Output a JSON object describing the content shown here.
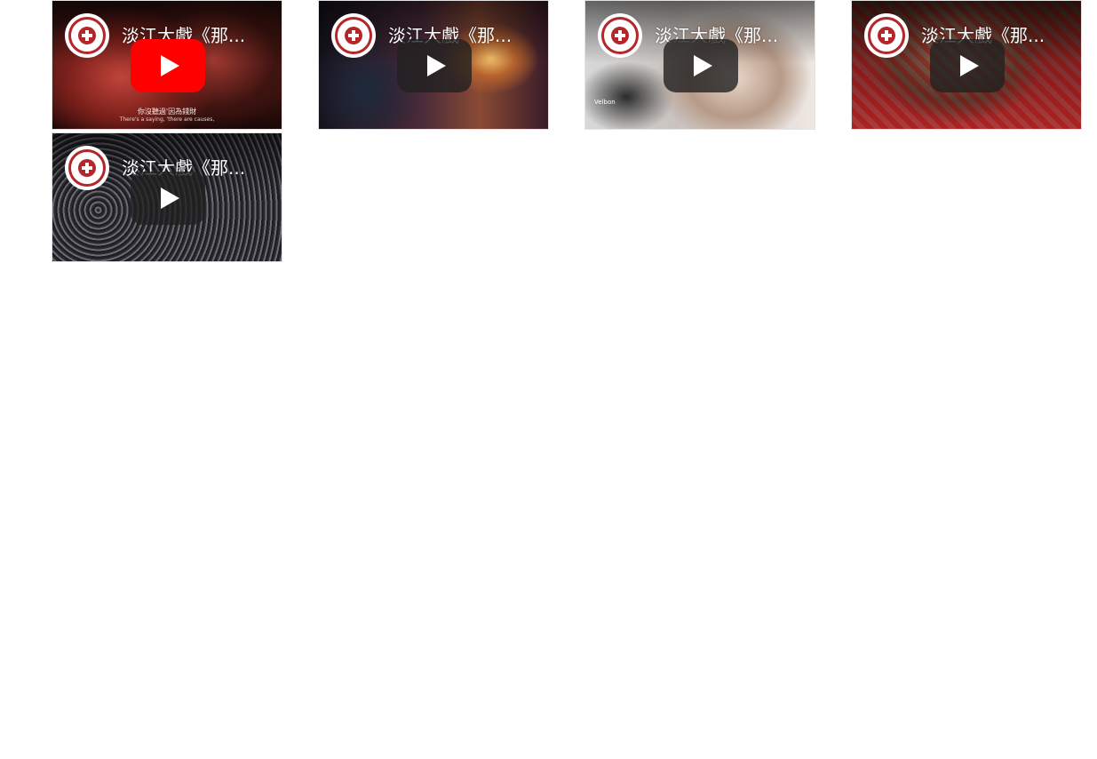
{
  "videos": [
    {
      "title": "淡江大戲《那...",
      "play_style": "red",
      "subtitle_zh": "你沒聽過'因為錢財",
      "subtitle_en": "There's a saying, 'there are causes,"
    },
    {
      "title": "淡江大戲《那...",
      "play_style": "dark"
    },
    {
      "title": "淡江大戲《那...",
      "play_style": "dark",
      "tripod_label": "Velbon"
    },
    {
      "title": "淡江大戲《那...",
      "play_style": "dark"
    },
    {
      "title": "淡江大戲《那...",
      "play_style": "dark"
    }
  ],
  "colors": {
    "youtube_red": "#ff0000",
    "logo_red": "#b3262a",
    "play_dark": "#212121"
  },
  "icons": {
    "play": "play-icon",
    "channel_logo": "channel-logo-icon"
  }
}
